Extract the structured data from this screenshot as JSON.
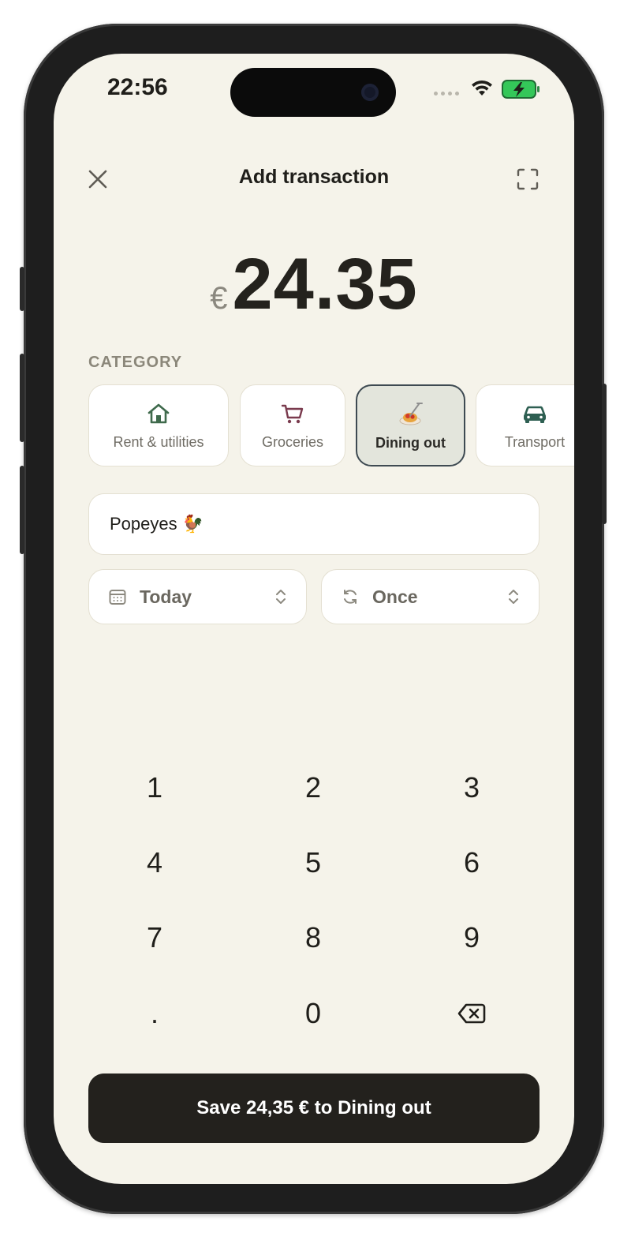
{
  "status_bar": {
    "time": "22:56"
  },
  "header": {
    "title": "Add transaction",
    "close_icon": "close-icon",
    "expand_icon": "expand-icon"
  },
  "amount": {
    "currency": "€",
    "value": "24.35"
  },
  "category": {
    "label": "CATEGORY",
    "items": [
      {
        "label": "Rent & utilities",
        "icon": "house-icon",
        "selected": false
      },
      {
        "label": "Groceries",
        "icon": "cart-icon",
        "selected": false
      },
      {
        "label": "Dining out",
        "icon": "spaghetti-icon",
        "selected": true
      },
      {
        "label": "Transport",
        "icon": "car-icon",
        "selected": false
      }
    ]
  },
  "note": {
    "value": "Popeyes 🐓"
  },
  "date_selector": {
    "label": "Today",
    "icon": "calendar-icon"
  },
  "repeat_selector": {
    "label": "Once",
    "icon": "repeat-icon"
  },
  "keypad": {
    "keys": [
      "1",
      "2",
      "3",
      "4",
      "5",
      "6",
      "7",
      "8",
      "9",
      ".",
      "0",
      "backspace"
    ]
  },
  "save_button": {
    "label": "Save 24,35 € to Dining out"
  },
  "colors": {
    "background": "#f5f3ea",
    "selected_category_border": "#3e4a52",
    "save_button": "#23211d",
    "battery_green": "#34c759"
  }
}
